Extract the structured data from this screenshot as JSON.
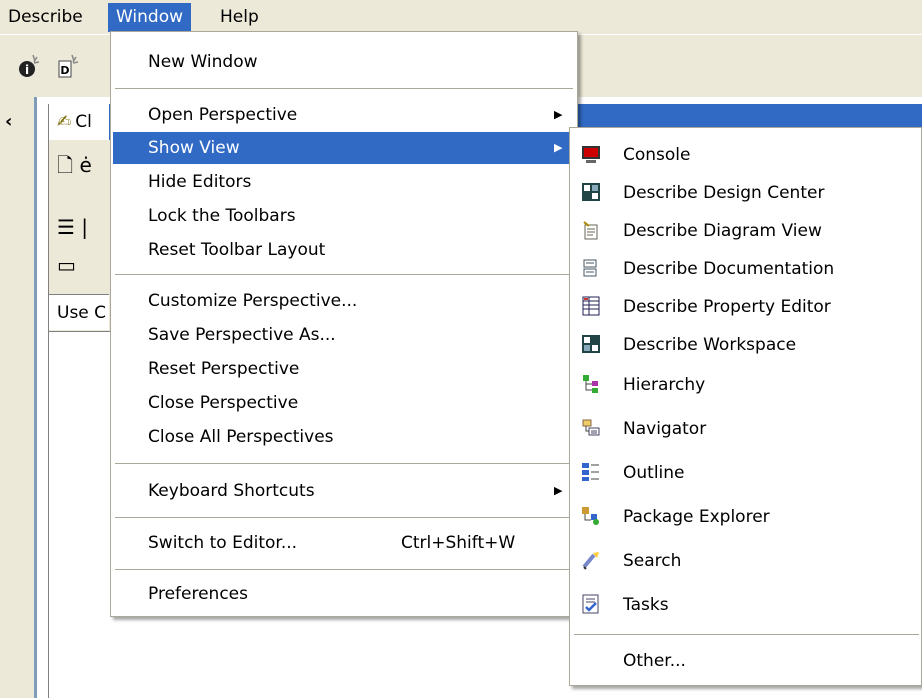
{
  "menubar": {
    "items": [
      "Describe",
      "Window",
      "Help"
    ]
  },
  "toolbar": {
    "icons": [
      "info-wizard-icon",
      "diagram-wizard-icon"
    ]
  },
  "panel": {
    "tab_label": "Cl",
    "row1_text": "ė",
    "row2_text": "|",
    "header_label": "Use C"
  },
  "window_menu": {
    "new_window": "New Window",
    "open_perspective": "Open Perspective",
    "show_view": "Show View",
    "hide_editors": "Hide Editors",
    "lock_toolbars": "Lock the Toolbars",
    "reset_toolbar_layout": "Reset Toolbar Layout",
    "customize_perspective": "Customize Perspective...",
    "save_perspective_as": "Save Perspective As...",
    "reset_perspective": "Reset Perspective",
    "close_perspective": "Close Perspective",
    "close_all_perspectives": "Close All Perspectives",
    "keyboard_shortcuts": "Keyboard Shortcuts",
    "switch_to_editor": "Switch to Editor...",
    "switch_to_editor_shortcut": "Ctrl+Shift+W",
    "preferences": "Preferences"
  },
  "show_view_menu": {
    "items": [
      {
        "label": "Console",
        "icon": "console-icon"
      },
      {
        "label": "Describe Design Center",
        "icon": "design-center-icon"
      },
      {
        "label": "Describe Diagram View",
        "icon": "diagram-view-icon"
      },
      {
        "label": "Describe Documentation",
        "icon": "documentation-icon"
      },
      {
        "label": "Describe Property Editor",
        "icon": "property-editor-icon"
      },
      {
        "label": "Describe Workspace",
        "icon": "workspace-icon"
      },
      {
        "label": "Hierarchy",
        "icon": "hierarchy-icon"
      },
      {
        "label": "Navigator",
        "icon": "navigator-icon"
      },
      {
        "label": "Outline",
        "icon": "outline-icon"
      },
      {
        "label": "Package Explorer",
        "icon": "package-explorer-icon"
      },
      {
        "label": "Search",
        "icon": "search-icon"
      },
      {
        "label": "Tasks",
        "icon": "tasks-icon"
      }
    ],
    "other": "Other..."
  },
  "colors": {
    "highlight": "#316ac5",
    "chrome": "#ece9d8"
  }
}
